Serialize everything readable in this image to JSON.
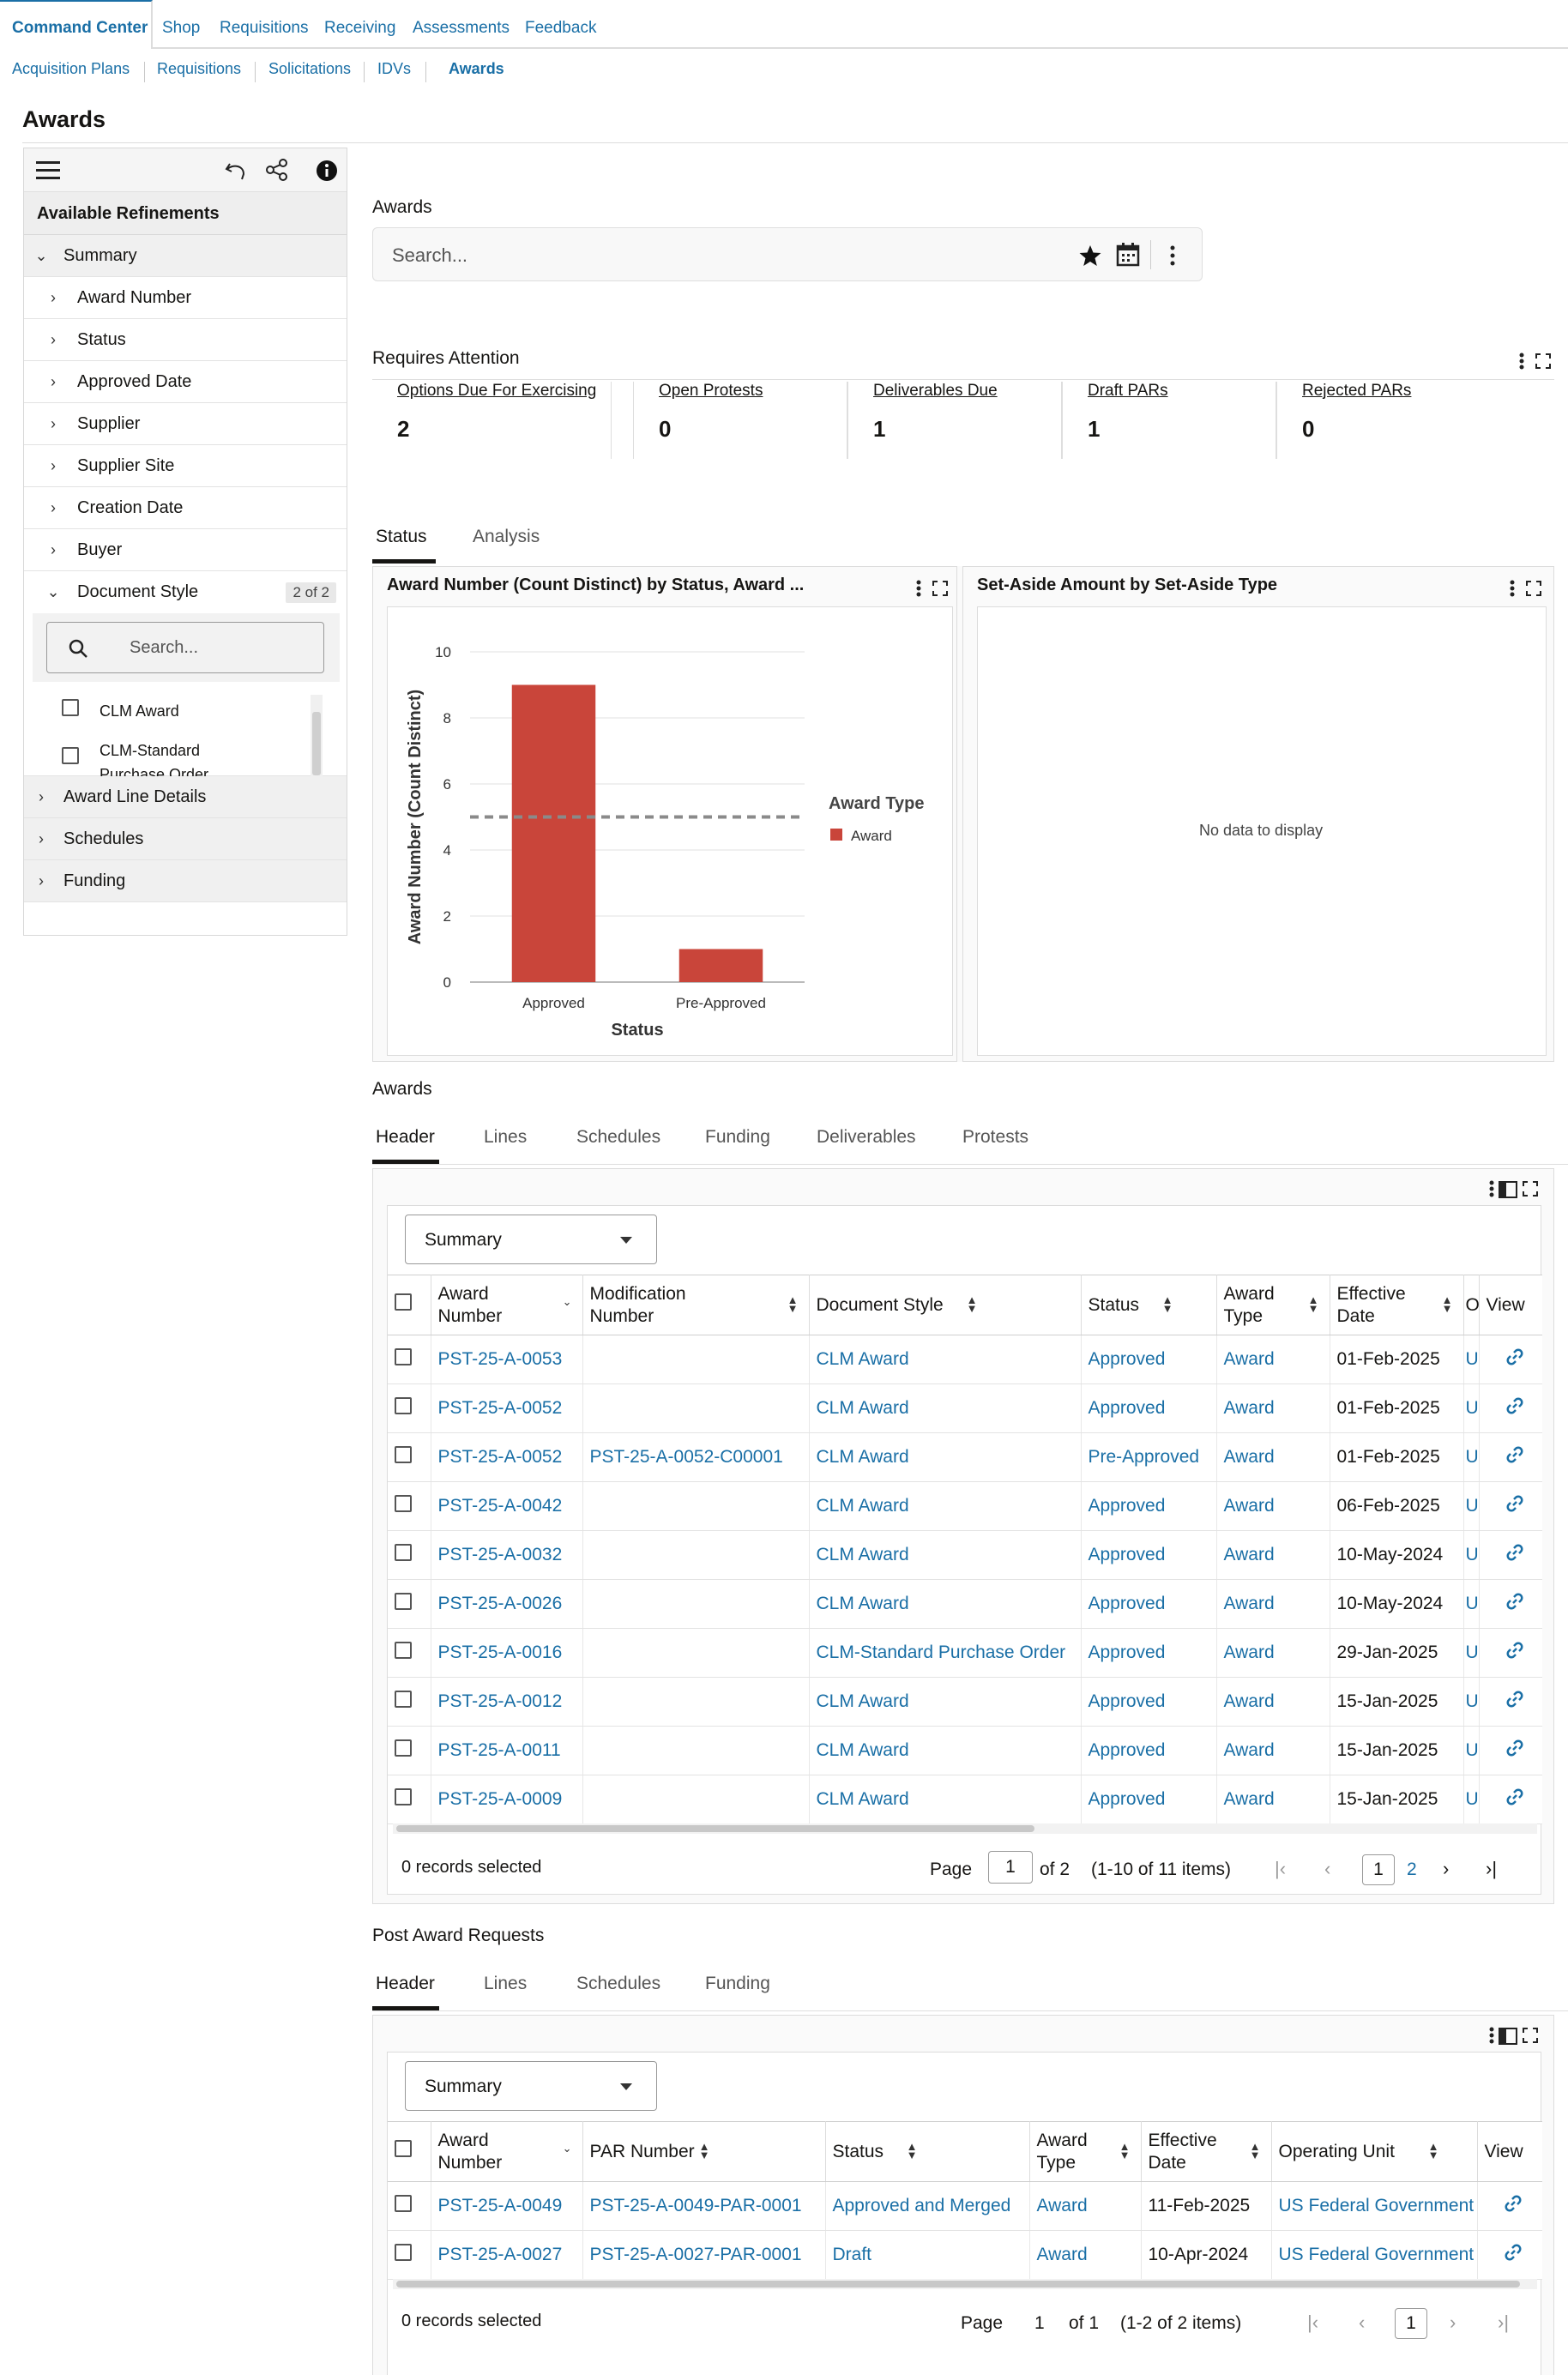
{
  "topnav": {
    "tabs": [
      "Command Center",
      "Shop",
      "Requisitions",
      "Receiving",
      "Assessments",
      "Feedback"
    ]
  },
  "subnav": {
    "items": [
      "Acquisition Plans",
      "Requisitions",
      "Solicitations",
      "IDVs",
      "Awards"
    ]
  },
  "page": {
    "title": "Awards"
  },
  "refinements": {
    "title": "Available Refinements",
    "summary_label": "Summary",
    "items": [
      "Award Number",
      "Status",
      "Approved Date",
      "Supplier",
      "Supplier Site",
      "Creation Date",
      "Buyer"
    ],
    "document_style": {
      "label": "Document Style",
      "badge": "2 of 2",
      "search_placeholder": "Search...",
      "options": [
        "CLM Award",
        "CLM-Standard Purchase Order"
      ]
    },
    "groups": [
      "Award Line Details",
      "Schedules",
      "Funding"
    ]
  },
  "search": {
    "label": "Awards",
    "placeholder": "Search..."
  },
  "attention": {
    "title": "Requires Attention",
    "cards": [
      {
        "label": "Options Due For Exercising",
        "value": "2"
      },
      {
        "label": "Open Protests",
        "value": "0"
      },
      {
        "label": "Deliverables Due",
        "value": "1"
      },
      {
        "label": "Draft PARs",
        "value": "1"
      },
      {
        "label": "Rejected PARs",
        "value": "0"
      }
    ]
  },
  "view_tabs": [
    "Status",
    "Analysis"
  ],
  "chart_card": {
    "title": "Award Number (Count Distinct) by Status, Award ...",
    "legend_title": "Award Type",
    "legend_item": "Award"
  },
  "chart_data": {
    "type": "bar",
    "categories": [
      "Approved",
      "Pre-Approved"
    ],
    "series": [
      {
        "name": "Award",
        "values": [
          9,
          1
        ]
      }
    ],
    "reference_line": 5,
    "xlabel": "Status",
    "ylabel": "Award Number (Count Distinct)",
    "ylim": [
      0,
      10
    ],
    "yticks": [
      "0",
      "2",
      "4",
      "6",
      "8",
      "10"
    ],
    "legend_title": "Award Type",
    "bar_color": "#c9453a"
  },
  "setaside_card": {
    "title": "Set-Aside Amount by Set-Aside Type",
    "empty": "No data to display"
  },
  "awards": {
    "label": "Awards",
    "tabs": [
      "Header",
      "Lines",
      "Schedules",
      "Funding",
      "Deliverables",
      "Protests"
    ],
    "view": "Summary",
    "columns": [
      "Award Number",
      "Modification Number",
      "Document Style",
      "Status",
      "Award Type",
      "Effective Date",
      "O",
      "View"
    ],
    "rows": [
      [
        "PST-25-A-0053",
        "",
        "CLM Award",
        "Approved",
        "Award",
        "01-Feb-2025",
        "U"
      ],
      [
        "PST-25-A-0052",
        "",
        "CLM Award",
        "Approved",
        "Award",
        "01-Feb-2025",
        "U"
      ],
      [
        "PST-25-A-0052",
        "PST-25-A-0052-C00001",
        "CLM Award",
        "Pre-Approved",
        "Award",
        "01-Feb-2025",
        "U"
      ],
      [
        "PST-25-A-0042",
        "",
        "CLM Award",
        "Approved",
        "Award",
        "06-Feb-2025",
        "U"
      ],
      [
        "PST-25-A-0032",
        "",
        "CLM Award",
        "Approved",
        "Award",
        "10-May-2024",
        "U"
      ],
      [
        "PST-25-A-0026",
        "",
        "CLM Award",
        "Approved",
        "Award",
        "10-May-2024",
        "U"
      ],
      [
        "PST-25-A-0016",
        "",
        "CLM-Standard Purchase Order",
        "Approved",
        "Award",
        "29-Jan-2025",
        "U"
      ],
      [
        "PST-25-A-0012",
        "",
        "CLM Award",
        "Approved",
        "Award",
        "15-Jan-2025",
        "U"
      ],
      [
        "PST-25-A-0011",
        "",
        "CLM Award",
        "Approved",
        "Award",
        "15-Jan-2025",
        "U"
      ],
      [
        "PST-25-A-0009",
        "",
        "CLM Award",
        "Approved",
        "Award",
        "15-Jan-2025",
        "U"
      ]
    ],
    "selected": "0 records selected",
    "pager": {
      "page_label": "Page",
      "page": "1",
      "of": "of 2",
      "range": "(1-10 of 11 items)",
      "pages": [
        "1",
        "2"
      ]
    }
  },
  "par": {
    "label": "Post Award Requests",
    "tabs": [
      "Header",
      "Lines",
      "Schedules",
      "Funding"
    ],
    "view": "Summary",
    "columns": [
      "Award Number",
      "PAR Number",
      "Status",
      "Award Type",
      "Effective Date",
      "Operating Unit",
      "View"
    ],
    "rows": [
      [
        "PST-25-A-0049",
        "PST-25-A-0049-PAR-0001",
        "Approved and Merged",
        "Award",
        "11-Feb-2025",
        "US Federal Government"
      ],
      [
        "PST-25-A-0027",
        "PST-25-A-0027-PAR-0001",
        "Draft",
        "Award",
        "10-Apr-2024",
        "US Federal Government"
      ]
    ],
    "selected": "0 records selected",
    "pager": {
      "page_label": "Page",
      "page": "1",
      "of": "of 1",
      "range": "(1-2 of 2 items)",
      "pages": [
        "1"
      ]
    }
  },
  "colors": {
    "link": "#1a6fa6",
    "bar": "#c9453a"
  }
}
